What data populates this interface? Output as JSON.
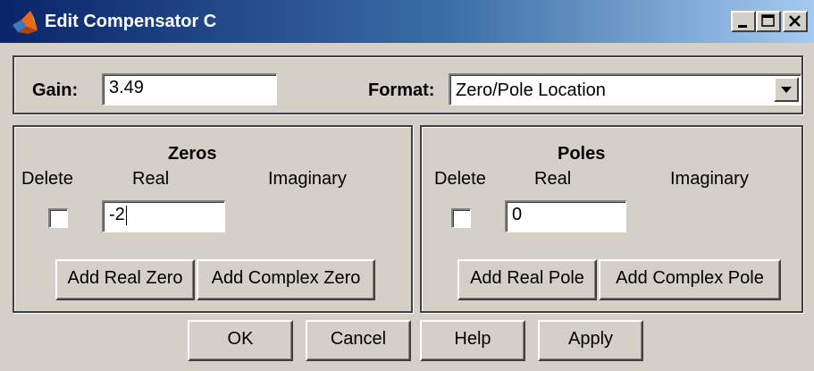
{
  "window": {
    "title": "Edit Compensator C",
    "title_color": "#ffffff",
    "titlebar_colors": [
      "#0a246a",
      "#a6caf0"
    ],
    "face_color": "#d4d0c8",
    "icon": "matlab-logo-icon",
    "controls": [
      "minimize-icon",
      "maximize-icon",
      "close-icon"
    ]
  },
  "gain": {
    "label": "Gain:",
    "value": "3.49"
  },
  "format": {
    "label": "Format:",
    "selected": "Zero/Pole Location",
    "arrow_icon": "chevron-down-icon"
  },
  "zeros": {
    "heading": "Zeros",
    "columns": {
      "delete": "Delete",
      "real": "Real",
      "imaginary": "Imaginary"
    },
    "rows": [
      {
        "checked": false,
        "real": "-2",
        "imaginary": ""
      }
    ],
    "add_real_button": "Add Real Zero",
    "add_complex_button": "Add Complex Zero"
  },
  "poles": {
    "heading": "Poles",
    "columns": {
      "delete": "Delete",
      "real": "Real",
      "imaginary": "Imaginary"
    },
    "rows": [
      {
        "checked": false,
        "real": "0",
        "imaginary": ""
      }
    ],
    "add_real_button": "Add Real Pole",
    "add_complex_button": "Add Complex Pole"
  },
  "buttons": {
    "ok": "OK",
    "cancel": "Cancel",
    "help": "Help",
    "apply": "Apply"
  }
}
